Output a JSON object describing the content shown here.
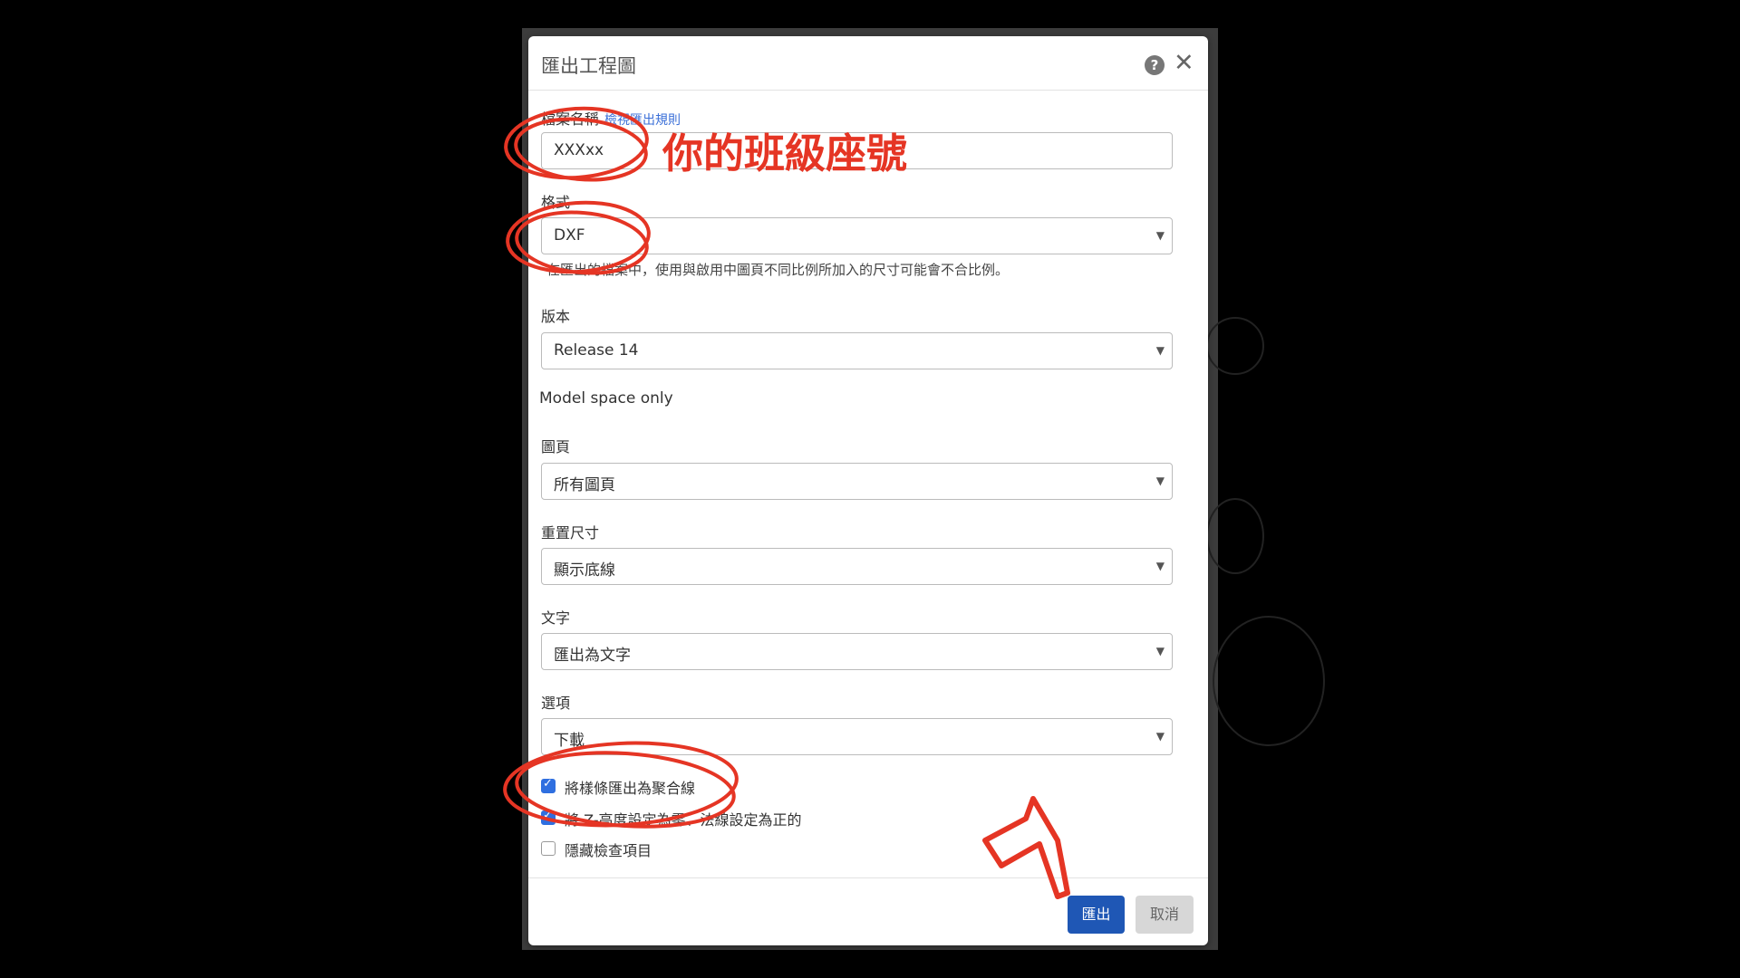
{
  "dialog": {
    "title": "匯出工程圖",
    "filename_label": "檔案名稱",
    "filename_link": "檢視匯出規則",
    "filename_value": "XXXxx",
    "format_label": "格式",
    "format_value": "DXF",
    "format_note": "在匯出的檔案中，使用與啟用中圖頁不同比例所加入的尺寸可能會不合比例。",
    "version_label": "版本",
    "version_value": "Release 14",
    "model_space": "Model space only",
    "sheets_label": "圖頁",
    "sheets_value": "所有圖頁",
    "resize_label": "重置尺寸",
    "resize_value": "顯示底線",
    "text_label": "文字",
    "text_value": "匯出為文字",
    "options_label": "選項",
    "options_value": "下載",
    "checkboxes": [
      {
        "label": "將樣條匯出為聚合線",
        "checked": true
      },
      {
        "label": "將 Z-高度設定為零、法線設定為正的",
        "checked": true
      },
      {
        "label": "隱藏檢查項目",
        "checked": false
      }
    ],
    "export_button": "匯出",
    "cancel_button": "取消"
  },
  "annotation": {
    "text": "你的班級座號",
    "color": "#e53524"
  },
  "icons": [
    "help-icon",
    "close-icon",
    "dropdown-arrow-icon",
    "check-icon"
  ]
}
